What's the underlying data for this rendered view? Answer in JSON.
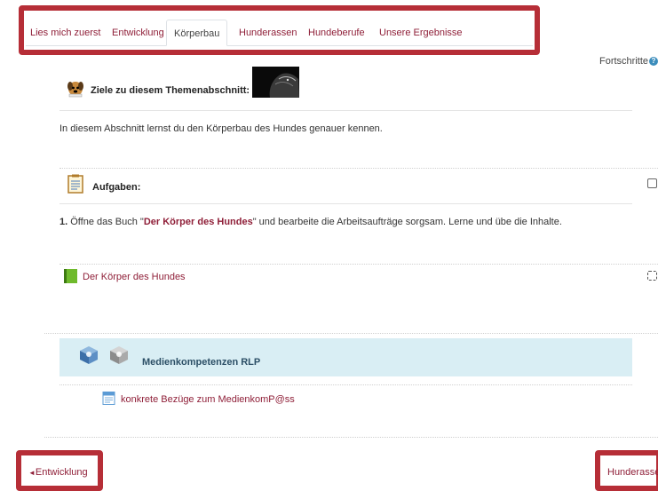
{
  "tabs": [
    {
      "label": "Lies mich zuerst",
      "active": false
    },
    {
      "label": "Entwicklung",
      "active": false
    },
    {
      "label": "Körperbau",
      "active": true
    },
    {
      "label": "Hunderassen",
      "active": false
    },
    {
      "label": "Hundeberufe",
      "active": false
    },
    {
      "label": "Unsere Ergebnisse",
      "active": false
    }
  ],
  "progress": {
    "label": "Fortschritte"
  },
  "goals": {
    "heading": "Ziele zu diesem Themenabschnitt:",
    "text": "In diesem Abschnitt lernst du den Körperbau des Hundes genauer kennen."
  },
  "tasks": {
    "heading": "Aufgaben:",
    "number": "1.",
    "before": " Öffne das Buch \"",
    "book_title": "Der Körper des Hundes",
    "after": "\" und bearbeite die Arbeitsaufträge sorgsam. Lerne und übe die Inhalte."
  },
  "activity": {
    "label": "Der Körper des Hundes"
  },
  "media": {
    "heading": "Medienkompetenzen RLP",
    "link": "konkrete Bezüge zum MedienkomP@ss"
  },
  "nav": {
    "prev_label": "Entwicklung",
    "prev_arrow": "◄",
    "next_label": "Hunderassen"
  },
  "colors": {
    "link": "#8f1f38",
    "highlight": "#b62e37",
    "media_bg": "#d9eef4"
  }
}
